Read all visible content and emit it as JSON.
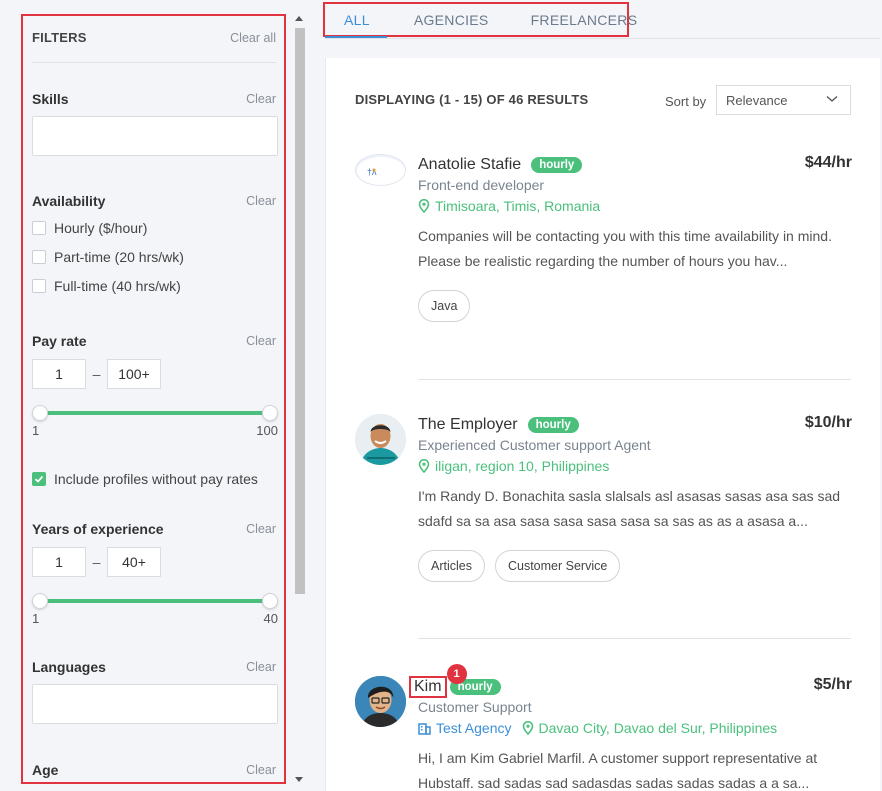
{
  "filters": {
    "title": "FILTERS",
    "clear_all": "Clear all",
    "skills": {
      "label": "Skills",
      "clear": "Clear",
      "placeholder": ""
    },
    "availability": {
      "label": "Availability",
      "clear": "Clear",
      "options": [
        {
          "label": "Hourly ($/hour)",
          "checked": false
        },
        {
          "label": "Part-time (20 hrs/wk)",
          "checked": false
        },
        {
          "label": "Full-time (40 hrs/wk)",
          "checked": false
        }
      ]
    },
    "pay_rate": {
      "label": "Pay rate",
      "clear": "Clear",
      "min": "1",
      "max": "100+",
      "dash": "–",
      "slider_min_label": "1",
      "slider_max_label": "100"
    },
    "include_no_rates": {
      "label": "Include profiles without pay rates",
      "checked": true
    },
    "experience": {
      "label": "Years of experience",
      "clear": "Clear",
      "min": "1",
      "max": "40+",
      "dash": "–",
      "slider_min_label": "1",
      "slider_max_label": "40"
    },
    "languages": {
      "label": "Languages",
      "clear": "Clear"
    },
    "age": {
      "label": "Age",
      "clear": "Clear"
    }
  },
  "tabs": [
    {
      "label": "ALL",
      "active": true
    },
    {
      "label": "AGENCIES",
      "active": false
    },
    {
      "label": "FREELANCERS",
      "active": false
    }
  ],
  "results": {
    "header": "DISPLAYING (1 - 15) OF 46 RESULTS",
    "sort_label": "Sort by",
    "sort_value": "Relevance"
  },
  "profiles": [
    {
      "name": "Anatolie Stafie",
      "badge": "hourly",
      "rate": "$44/hr",
      "title": "Front-end developer",
      "location": "Timisoara, Timis, Romania",
      "desc_line1": "Companies will be contacting you with this time availability in mind.",
      "desc_line2": "Please be realistic regarding the number of hours you hav...",
      "tags": [
        "Java"
      ]
    },
    {
      "name": "The Employer",
      "badge": "hourly",
      "rate": "$10/hr",
      "title": "Experienced Customer support Agent",
      "location": "iligan, region 10, Philippines",
      "desc_line1": "I'm Randy D. Bonachita sasla slalsals asl asasas sasas asa sas sad",
      "desc_line2": "sdafd sa sa asa sasa sasa sasa sasa sa sas as as a asasa a...",
      "tags": [
        "Articles",
        "Customer Service"
      ]
    },
    {
      "name": "Kim",
      "badge": "hourly",
      "rate": "$5/hr",
      "title": "Customer Support",
      "agency": "Test Agency",
      "location": "Davao City, Davao del Sur, Philippines",
      "desc_line1": "Hi, I am Kim Gabriel Marfil. A customer support representative at",
      "desc_line2": "Hubstaff. sad sadas sad sadasdas sadas sadas sadas a a sa...",
      "notification": "1"
    }
  ],
  "colors": {
    "accent_green": "#4bc07d",
    "accent_blue": "#3b8fd9",
    "highlight_red": "#e0333f"
  }
}
